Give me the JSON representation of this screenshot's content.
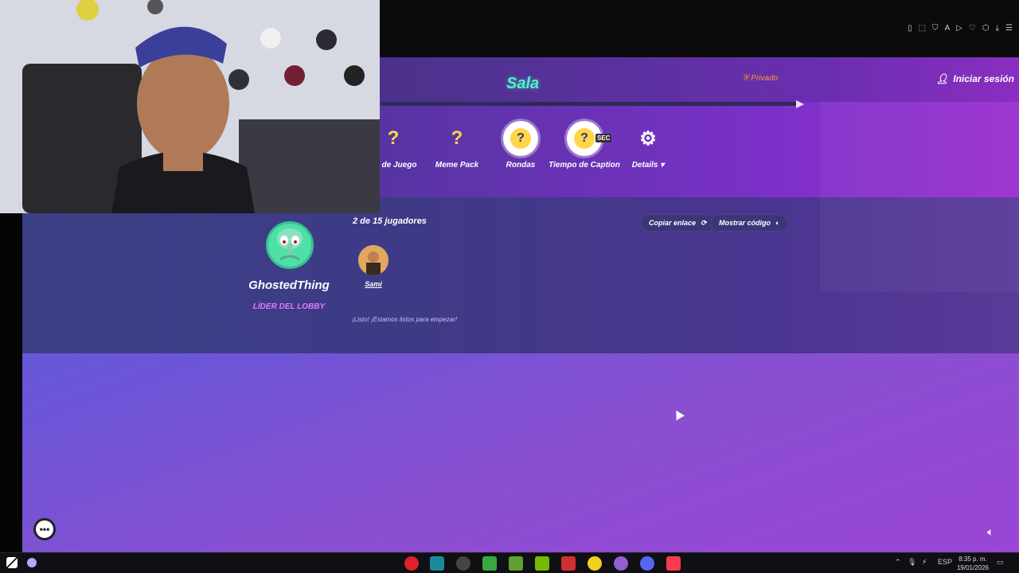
{
  "header": {
    "title": "Sala",
    "privacy": "Privado",
    "login": "Iniciar sesión"
  },
  "settings": [
    {
      "label": "do de Juego",
      "icon": "question-icon"
    },
    {
      "label": "Meme Pack",
      "icon": "question-icon"
    },
    {
      "label": "Rondas",
      "icon": "question-badge-icon"
    },
    {
      "label": "Tiempo de Caption",
      "icon": "timer-badge-icon",
      "tag": "SEC"
    },
    {
      "label": "Details",
      "icon": "gear-icon"
    }
  ],
  "lobby": {
    "player_count": "2 de  15 jugadores",
    "copy_link": "Copiar enlace",
    "show_code": "Mostrar código",
    "leader": {
      "name": "GhostedThing",
      "role": "LÍDER DEL LOBBY"
    },
    "players": [
      {
        "name": "Sami"
      }
    ],
    "ready_message": "¡Listo! ¡Estamos listos para empezar!"
  },
  "taskbar": {
    "language": "ESP",
    "time": "8:35 p. m.",
    "date": "19/01/2026"
  },
  "colors": {
    "title": "#4ff0c8",
    "privacy": "#ff9a30",
    "leader_role": "#e07aff",
    "icon_yellow": "#ffd54a"
  }
}
